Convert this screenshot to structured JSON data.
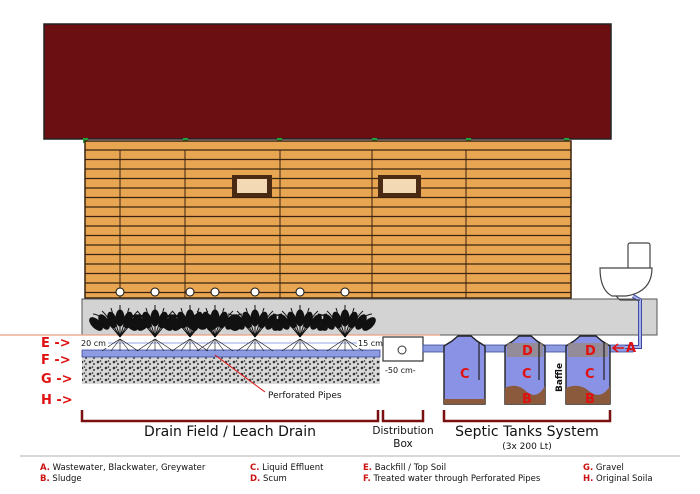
{
  "labels": {
    "row_E": "E ->",
    "row_F": "F ->",
    "row_G": "G ->",
    "row_H": "H ->",
    "dim_20cm": "20 cm",
    "dim_15cm": "15 cm",
    "dim_50cm": "-50 cm-",
    "perforated_pipes": "Perforated Pipes",
    "baffle": "Baffle",
    "A": "A",
    "B": "B",
    "C": "C",
    "D": "D"
  },
  "sections": {
    "drain_field": "Drain Field / Leach Drain",
    "distribution_box_line1": "Distribution",
    "distribution_box_line2": "Box",
    "septic_tanks": "Septic Tanks System",
    "septic_capacity": "(3x 200 Lt)"
  },
  "legend": [
    {
      "key": "A.",
      "text": "Wastewater, Blackwater, Greywater"
    },
    {
      "key": "B.",
      "text": "Sludge"
    },
    {
      "key": "C.",
      "text": "Liquid Effluent"
    },
    {
      "key": "D.",
      "text": "Scum"
    },
    {
      "key": "E.",
      "text": "Backfill / Top Soil"
    },
    {
      "key": "F.",
      "text": "Treated water through Perforated Pipes"
    },
    {
      "key": "G.",
      "text": "Gravel"
    },
    {
      "key": "H.",
      "text": "Original Soila"
    }
  ],
  "colors": {
    "roof": "#6b0f12",
    "wall": "#e8a552",
    "plank_line": "#3a2410",
    "foundation": "#d3d3d3",
    "pipe": "#8d9be0",
    "tank_fill": "#8a92e6",
    "sludge": "#8b5a3c",
    "bracket": "#7a1010",
    "label_red": "#e01010"
  }
}
